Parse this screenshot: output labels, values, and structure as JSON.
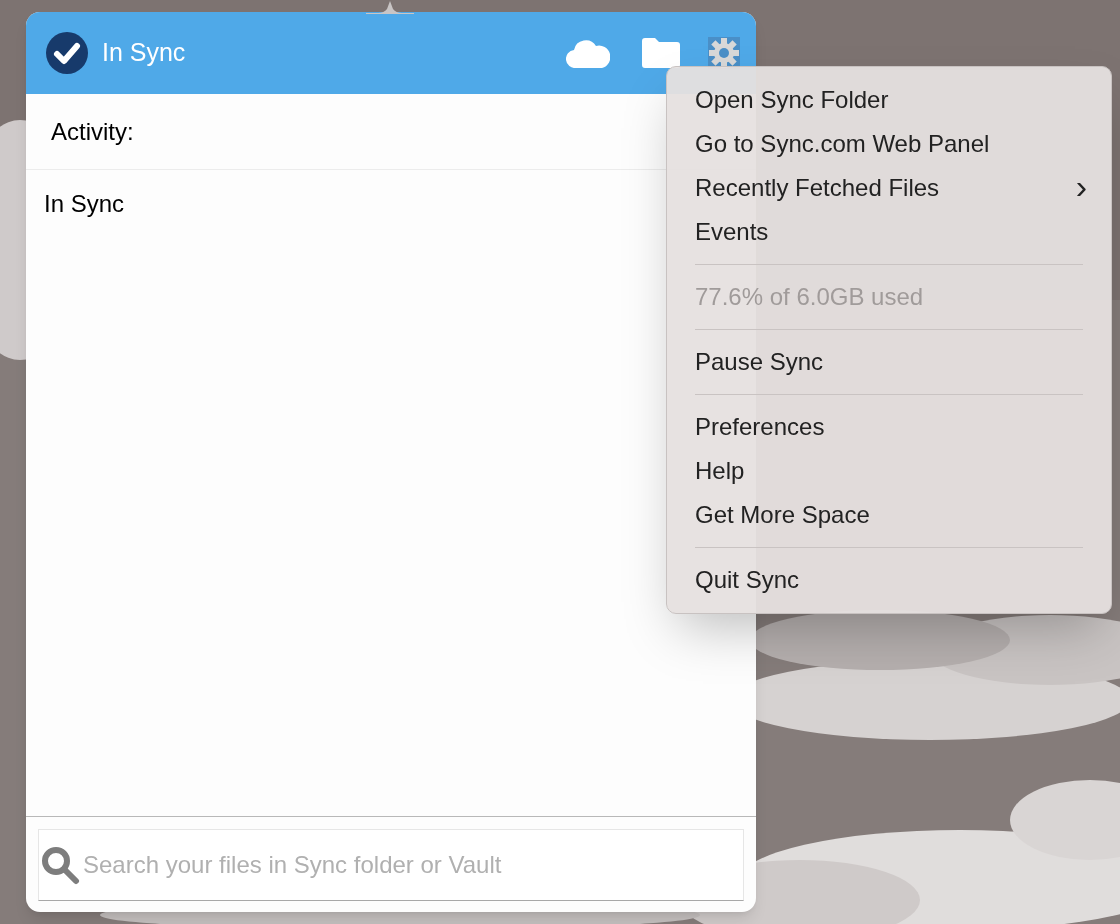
{
  "header": {
    "status": "In Sync"
  },
  "activity": {
    "label": "Activity:",
    "entries": [
      "In Sync"
    ]
  },
  "search": {
    "placeholder": "Search your files in Sync folder or Vault"
  },
  "menu": [
    {
      "kind": "item",
      "label": "Open Sync Folder"
    },
    {
      "kind": "item",
      "label": "Go to Sync.com Web Panel"
    },
    {
      "kind": "item",
      "label": "Recently Fetched Files",
      "arrow": "›"
    },
    {
      "kind": "item",
      "label": "Events"
    },
    {
      "kind": "separator"
    },
    {
      "kind": "info",
      "label": "77.6% of 6.0GB used"
    },
    {
      "kind": "separator"
    },
    {
      "kind": "item",
      "label": "Pause Sync"
    },
    {
      "kind": "separator"
    },
    {
      "kind": "item",
      "label": "Preferences"
    },
    {
      "kind": "item",
      "label": "Help"
    },
    {
      "kind": "item",
      "label": "Get More Space"
    },
    {
      "kind": "separator"
    },
    {
      "kind": "item",
      "label": "Quit Sync"
    }
  ]
}
